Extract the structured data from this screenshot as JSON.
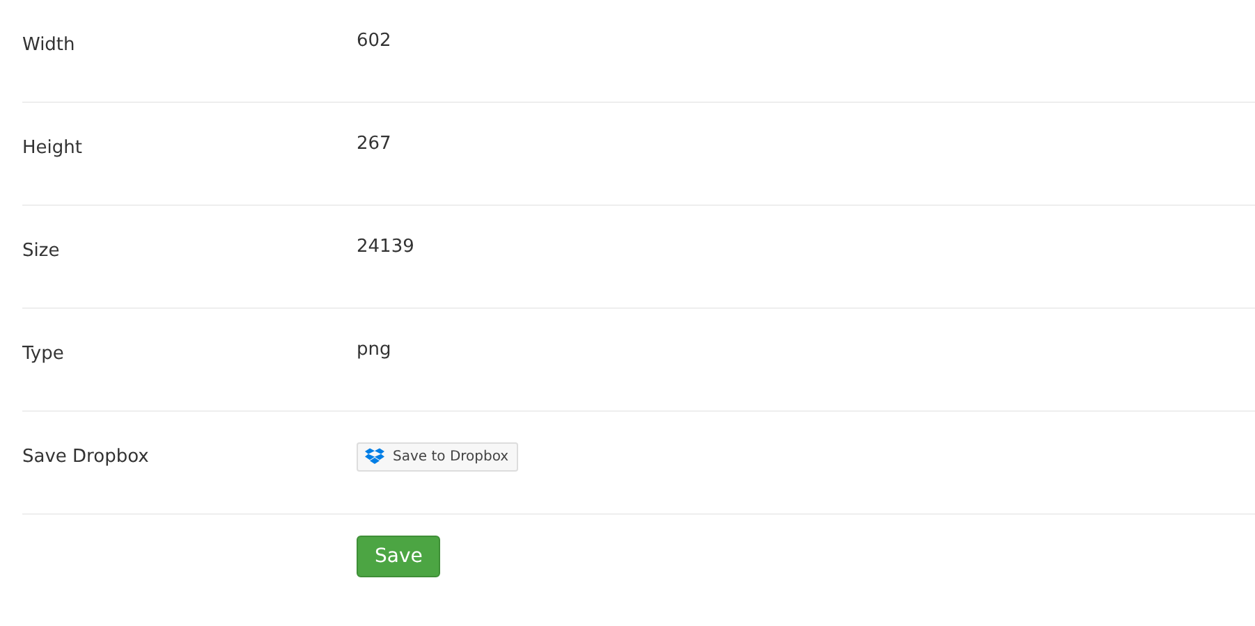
{
  "rows": [
    {
      "kind": "text",
      "label": "Width",
      "value": "602"
    },
    {
      "kind": "text",
      "label": "Height",
      "value": "267"
    },
    {
      "kind": "text",
      "label": "Size",
      "value": "24139"
    },
    {
      "kind": "text",
      "label": "Type",
      "value": "png"
    },
    {
      "kind": "dropbox",
      "label": "Save Dropbox",
      "value": "Save to Dropbox"
    }
  ],
  "submit": "Save"
}
